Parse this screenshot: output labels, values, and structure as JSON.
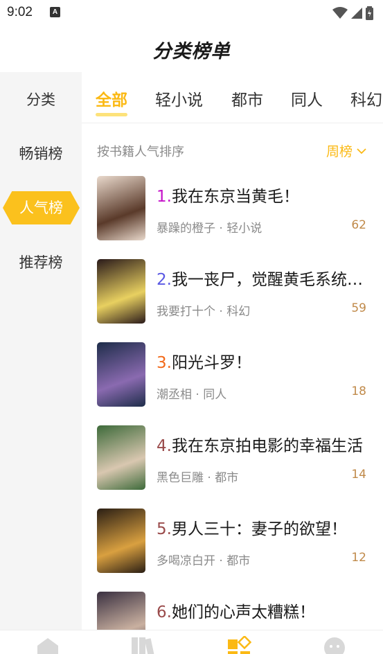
{
  "status_bar": {
    "time": "9:02",
    "notification_icon": "a-icon"
  },
  "header": {
    "title": "分类榜单"
  },
  "sidebar": {
    "items": [
      {
        "label": "分类",
        "active": false
      },
      {
        "label": "畅销榜",
        "active": false
      },
      {
        "label": "人气榜",
        "active": true
      },
      {
        "label": "推荐榜",
        "active": false
      }
    ]
  },
  "tabs": [
    {
      "label": "全部",
      "active": true
    },
    {
      "label": "轻小说",
      "active": false
    },
    {
      "label": "都市",
      "active": false
    },
    {
      "label": "同人",
      "active": false
    },
    {
      "label": "科幻",
      "active": false
    }
  ],
  "sort": {
    "label": "按书籍人气排序",
    "selected": "周榜"
  },
  "books": [
    {
      "rank": "1.",
      "rank_color": "#c513c9",
      "title": "我在东京当黄毛！",
      "author": "暴躁的橙子 · 轻小说",
      "count": "62",
      "cover_colors": [
        "#e9d9cc",
        "#5a3a2a"
      ]
    },
    {
      "rank": "2.",
      "rank_color": "#5a59e3",
      "title": "我一丧尸，觉醒黄毛系统有何用？",
      "author": "我要打十个 · 科幻",
      "count": "59",
      "cover_colors": [
        "#2a1a1a",
        "#e8d060"
      ]
    },
    {
      "rank": "3.",
      "rank_color": "#f26a1b",
      "title": "阳光斗罗！",
      "author": "潮丞相 · 同人",
      "count": "18",
      "cover_colors": [
        "#1e2d4a",
        "#8a6ab0"
      ]
    },
    {
      "rank": "4.",
      "rank_color": "#9a4b4b",
      "title": "我在东京拍电影的幸福生活",
      "author": "黑色巨雕 · 都市",
      "count": "14",
      "cover_colors": [
        "#3d6a3a",
        "#d9c7b0"
      ]
    },
    {
      "rank": "5.",
      "rank_color": "#9a4b4b",
      "title": "男人三十：妻子的欲望！",
      "author": "多喝凉白开 · 都市",
      "count": "12",
      "cover_colors": [
        "#2a1e14",
        "#d9a040"
      ]
    },
    {
      "rank": "6.",
      "rank_color": "#9a4b4b",
      "title": "她们的心声太糟糕！",
      "author": "",
      "count": "",
      "cover_colors": [
        "#3a3040",
        "#c9b0a0"
      ]
    }
  ],
  "bottom_nav": {
    "items": [
      {
        "icon": "home-icon",
        "active": false
      },
      {
        "icon": "bookshelf-icon",
        "active": false
      },
      {
        "icon": "category-icon",
        "active": true
      },
      {
        "icon": "profile-icon",
        "active": false
      }
    ],
    "active_color": "#fbb914",
    "inactive_color": "#d8d8d8"
  },
  "colors": {
    "accent": "#fbb914",
    "sidebar_bg": "#f5f5f5",
    "count": "#c08a4a"
  }
}
